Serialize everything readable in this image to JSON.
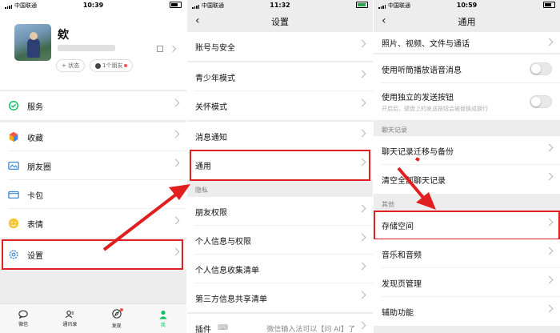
{
  "colors": {
    "accent": "#07c160",
    "highlight": "#e02020",
    "arrow": "#e02020"
  },
  "p1": {
    "status": {
      "carrier": "中国联通",
      "time": "10:39"
    },
    "profile": {
      "name": "欸",
      "wechat_id": "",
      "status_button": "+ 状态",
      "friends": "1个朋友"
    },
    "menu": {
      "services": "服务",
      "favorites": "收藏",
      "moments": "朋友圈",
      "cards": "卡包",
      "stickers": "表情",
      "settings": "设置"
    },
    "tabs": {
      "chats": "微信",
      "contacts": "通讯录",
      "discover": "发现",
      "me": "我"
    }
  },
  "p2": {
    "status": {
      "carrier": "中国联通",
      "time": "11:32"
    },
    "title": "设置",
    "items": {
      "account": "账号与安全",
      "teen": "青少年模式",
      "care": "关怀模式",
      "notify": "消息通知",
      "general": "通用",
      "privacy_header": "隐私",
      "friend_perm": "朋友权限",
      "personal_info": "个人信息与权限",
      "personal_collect": "个人信息收集清单",
      "third_party": "第三方信息共享清单",
      "plugins": "插件",
      "plugin_hint": "微信输入法可以【问 AI】了"
    }
  },
  "p3": {
    "status": {
      "carrier": "中国联通",
      "time": "10:59"
    },
    "title": "通用",
    "items": {
      "media": "照片、视频、文件与通话",
      "earpiece": "使用听筒播放语音消息",
      "send_button": "使用独立的发送按钮",
      "send_button_sub": "开启后，键盘上的发送按钮会被替换成换行",
      "chat_header": "聊天记录",
      "migrate": "聊天记录迁移与备份",
      "clear": "清空全部聊天记录",
      "other_header": "其他",
      "storage": "存储空间",
      "music": "音乐和音频",
      "discover_mgmt": "发现页管理",
      "accessibility": "辅助功能"
    }
  }
}
